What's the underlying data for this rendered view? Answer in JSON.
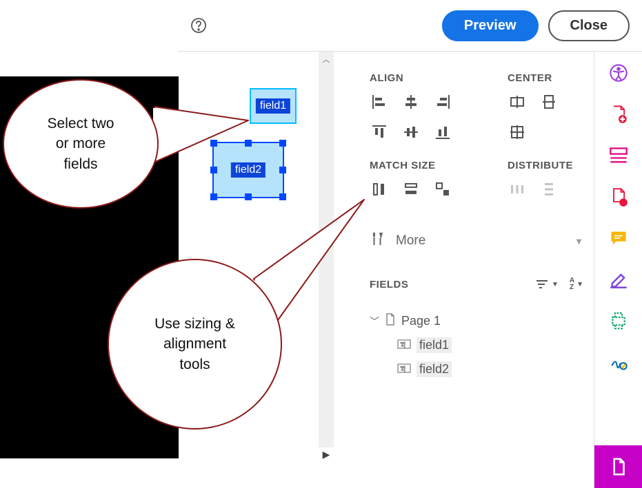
{
  "toolbar": {
    "preview_label": "Preview",
    "close_label": "Close"
  },
  "callouts": {
    "select": "Select two\nor more\nfields",
    "tools": "Use sizing &\nalignment\ntools"
  },
  "canvas": {
    "field1_label": "field1",
    "field2_label": "field2"
  },
  "panel": {
    "align_title": "ALIGN",
    "center_title": "CENTER",
    "match_title": "MATCH SIZE",
    "distribute_title": "DISTRIBUTE",
    "more_label": "More",
    "fields_title": "FIELDS"
  },
  "tree": {
    "page_label": "Page 1",
    "items": [
      "field1",
      "field2"
    ]
  },
  "colors": {
    "primary": "#1473E6",
    "callout_border": "#8b1a1a",
    "active_tool": "#c700c7"
  }
}
